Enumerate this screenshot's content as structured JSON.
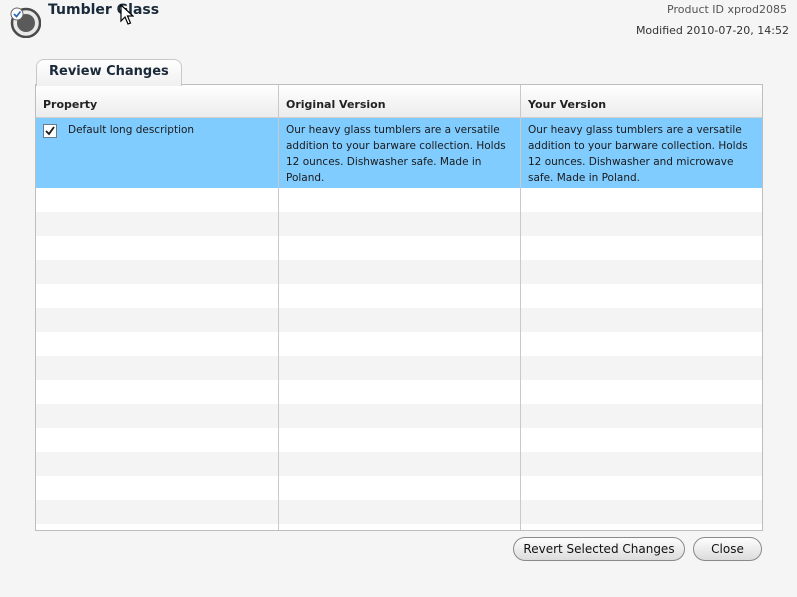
{
  "header": {
    "title": "Tumbler Glass",
    "product_id": "Product ID xprod2085",
    "modified": "Modified 2010-07-20, 14:52",
    "app_icon": "product-globe-icon"
  },
  "tab": {
    "label": "Review Changes"
  },
  "table": {
    "columns": [
      "Property",
      "Original Version",
      "Your Version"
    ],
    "rows": [
      {
        "checked": true,
        "property": "Default long description",
        "original": "Our heavy glass tumblers are a versatile addition to your barware collection. Holds 12 ounces. Dishwasher safe. Made in Poland.",
        "yours": "Our heavy glass tumblers are a versatile addition to your barware collection. Holds 12 ounces. Dishwasher and microwave safe. Made in Poland."
      }
    ],
    "selected_color": "#80ccff"
  },
  "buttons": {
    "revert": "Revert Selected Changes",
    "close": "Close"
  }
}
